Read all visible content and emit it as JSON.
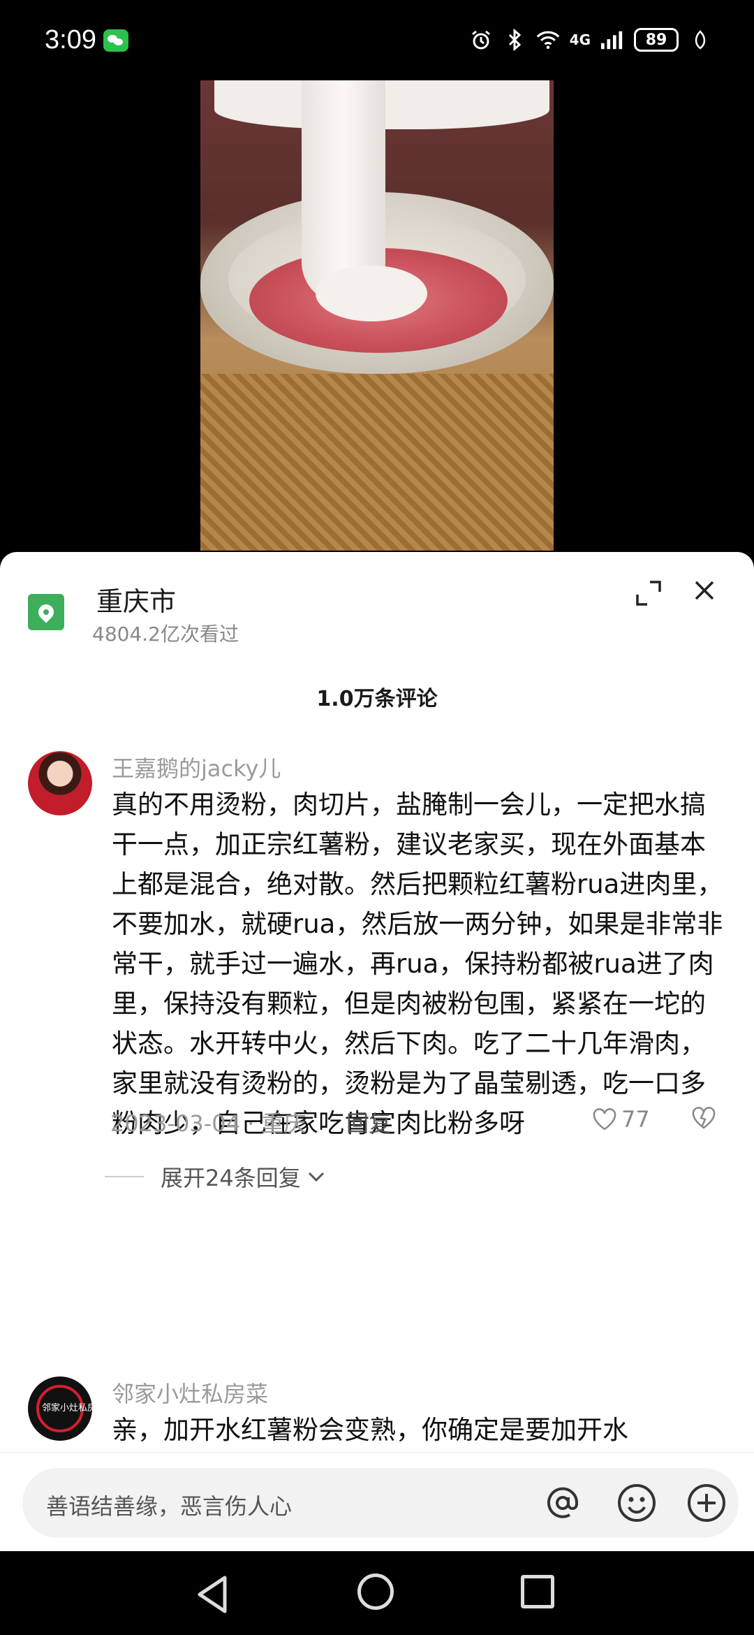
{
  "status_bar": {
    "time": "3:09",
    "network": "4G",
    "battery": "89"
  },
  "location": {
    "title": "重庆市",
    "views": "4804.2亿次看过"
  },
  "comments_header": "1.0万条评论",
  "comments": [
    {
      "user": "王嘉鹅的jacky儿",
      "text": "真的不用烫粉，肉切片，盐腌制一会儿，一定把水搞干一点，加正宗红薯粉，建议老家买，现在外面基本上都是混合，绝对散。然后把颗粒红薯粉rua进肉里，不要加水，就硬rua，然后放一两分钟，如果是非常非常干，就手过一遍水，再rua，保持粉都被rua进了肉里，保持没有颗粒，但是肉被粉包围，紧紧在一坨的状态。水开转中火，然后下肉。吃了二十几年滑肉，家里就没有烫粉的，烫粉是为了晶莹剔透，吃一口多粉肉少，自己在家吃肯定肉比粉多呀",
      "meta": "2023-03-04 · 重庆",
      "reply_label": "回复",
      "likes": "77",
      "expand_label": "展开24条回复"
    },
    {
      "user": "邻家小灶私房菜",
      "avatar_text": "邻家小灶私房菜",
      "text": "亲，加开水红薯粉会变熟，你确定是要加开水"
    }
  ],
  "input": {
    "placeholder": "善语结善缘，恶言伤人心"
  }
}
